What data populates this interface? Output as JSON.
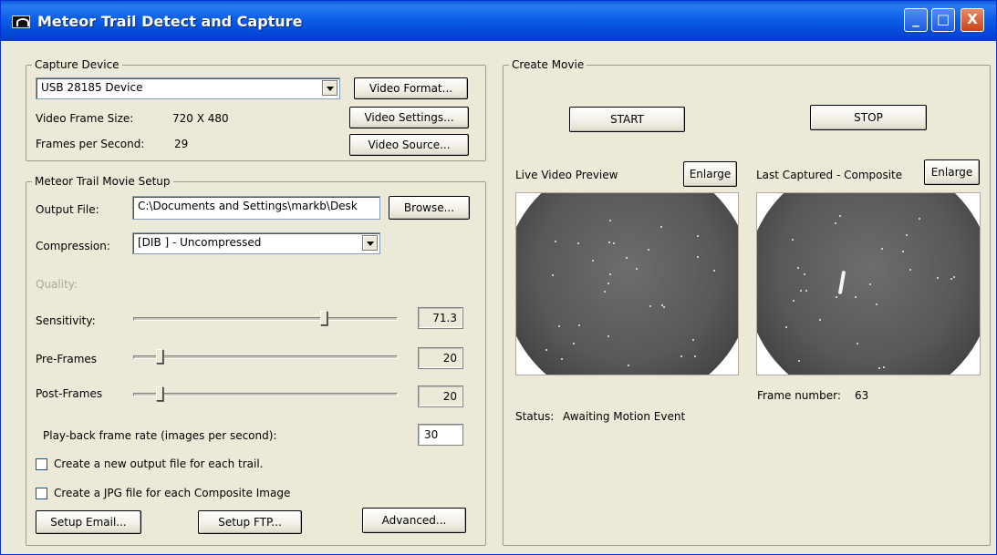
{
  "window": {
    "title": "Meteor Trail Detect and Capture",
    "controls": {
      "minimize": "_",
      "maximize": "□",
      "close": "X"
    }
  },
  "capture_device": {
    "group_label": "Capture Device",
    "device_value": "USB 28185 Device",
    "frame_size_label": "Video Frame Size:",
    "frame_size_value": "720 X 480",
    "fps_label": "Frames per Second:",
    "fps_value": "29",
    "buttons": {
      "video_format": "Video Format...",
      "video_settings": "Video Settings...",
      "video_source": "Video Source..."
    }
  },
  "movie_setup": {
    "group_label": "Meteor Trail Movie Setup",
    "output_file_label": "Output File:",
    "output_file_value": "C:\\Documents and Settings\\markb\\Desk",
    "browse_button": "Browse...",
    "compression_label": "Compression:",
    "compression_value": "[DIB ] - Uncompressed",
    "quality_label": "Quality:",
    "sensitivity_label": "Sensitivity:",
    "sensitivity_value": "71.3",
    "sensitivity_level": 0.72,
    "pre_frames_label": "Pre-Frames",
    "pre_frames_value": "20",
    "pre_frames_level": 0.1,
    "post_frames_label": "Post-Frames",
    "post_frames_value": "20",
    "post_frames_level": 0.1,
    "playback_label": "Play-back frame rate (images per second):",
    "playback_value": "30",
    "checkbox_new_file": "Create a new output file for each trail.",
    "checkbox_new_file_checked": false,
    "checkbox_jpg": "Create a JPG file for each Composite Image",
    "checkbox_jpg_checked": false,
    "setup_email_button": "Setup Email...",
    "setup_ftp_button": "Setup FTP...",
    "advanced_button": "Advanced..."
  },
  "create_movie": {
    "group_label": "Create Movie",
    "start_button": "START",
    "stop_button": "STOP",
    "live_preview_label": "Live Video Preview",
    "live_enlarge_button": "Enlarge",
    "composite_label": "Last Captured - Composite",
    "composite_enlarge_button": "Enlarge",
    "status_label": "Status:",
    "status_value": "Awaiting Motion Event",
    "frame_number_label": "Frame number:",
    "frame_number_value": "63"
  },
  "colors": {
    "titlebar": "#0a5fe6",
    "window_bg": "#ece9d8",
    "sky": "#585858"
  }
}
